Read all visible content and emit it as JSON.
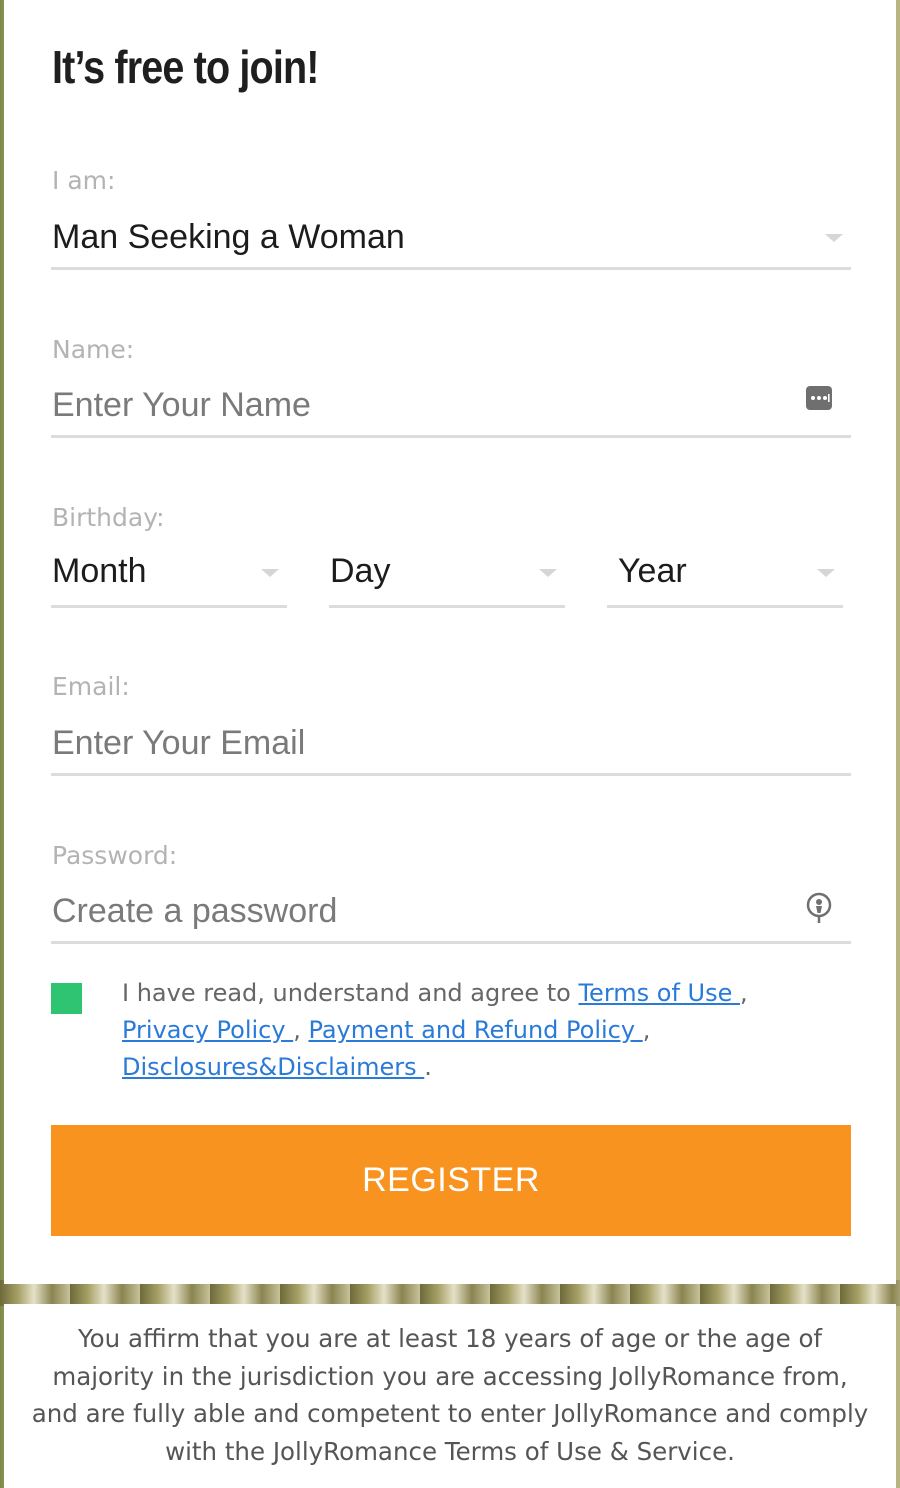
{
  "form": {
    "title": "It’s free to join!",
    "iam": {
      "label": "I am:",
      "value": "Man Seeking a Woman"
    },
    "name": {
      "label": "Name:",
      "placeholder": "Enter Your Name"
    },
    "birthday": {
      "label": "Birthday:",
      "month": "Month",
      "day": "Day",
      "year": "Year"
    },
    "email": {
      "label": "Email:",
      "placeholder": "Enter Your Email"
    },
    "password": {
      "label": "Password:",
      "placeholder": "Create a password"
    },
    "agreement": {
      "checked": true,
      "prefix": "I have read, understand and agree to ",
      "terms_link": "Terms of Use ",
      "sep1": ", ",
      "privacy_link": "Privacy Policy ",
      "sep2": ", ",
      "payment_link": "Payment and Refund Policy ",
      "sep3": ", ",
      "disclosures_link": "Disclosures&Disclaimers ",
      "suffix": "."
    },
    "register_label": "REGISTER"
  },
  "disclaimer": "You affirm that you are at least 18 years of age or the age of majority in the jurisdiction you are accessing JollyRomance from, and are fully able and competent to enter JollyRomance and comply with the JollyRomance Terms of Use & Service.",
  "colors": {
    "register": "#f7931e",
    "checkbox": "#2ec472",
    "link": "#2a7ad9"
  }
}
